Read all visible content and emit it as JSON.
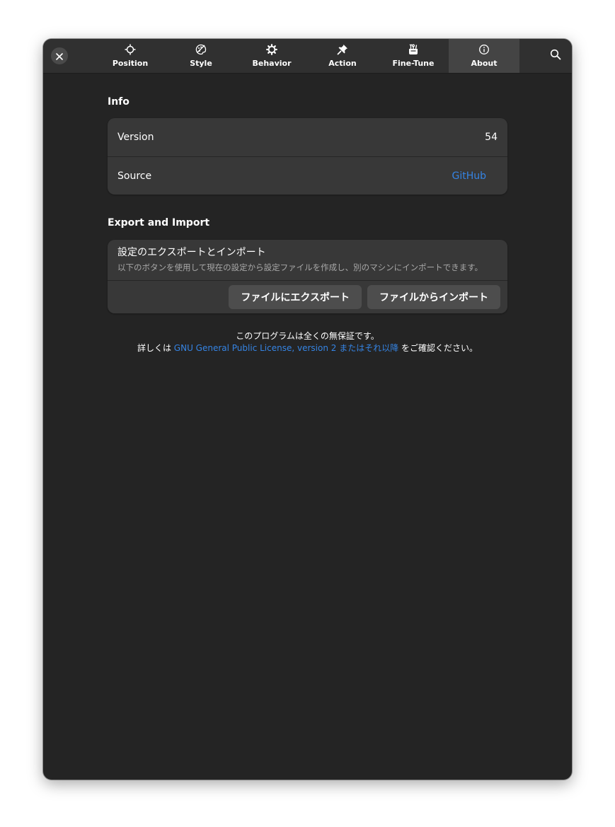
{
  "header": {
    "close_icon": "close-icon",
    "search_icon": "search-icon",
    "tabs": [
      {
        "label": "Position",
        "icon": "crosshair-icon",
        "active": false
      },
      {
        "label": "Style",
        "icon": "palette-icon",
        "active": false
      },
      {
        "label": "Behavior",
        "icon": "gear-icon",
        "active": false
      },
      {
        "label": "Action",
        "icon": "pin-icon",
        "active": false
      },
      {
        "label": "Fine-Tune",
        "icon": "tools-icon",
        "active": false
      },
      {
        "label": "About",
        "icon": "info-icon",
        "active": true
      }
    ]
  },
  "info": {
    "title": "Info",
    "rows": [
      {
        "label": "Version",
        "value": "54"
      },
      {
        "label": "Source",
        "value": "GitHub"
      }
    ]
  },
  "export_import": {
    "title": "Export and Import",
    "heading": "設定のエクスポートとインポート",
    "subtitle": "以下のボタンを使用して現在の設定から設定ファイルを作成し、別のマシンにインポートできます。",
    "export_button": "ファイルにエクスポート",
    "import_button": "ファイルからインポート"
  },
  "footer": {
    "line1": "このプログラムは全くの無保証です。",
    "line2_prefix": "詳しくは ",
    "line2_link": "GNU General Public License, version 2 またはそれ以降",
    "line2_suffix": " をご確認ください。"
  },
  "colors": {
    "background": "#242424",
    "headerbar": "#303030",
    "card": "#383838",
    "accent_link": "#3584e4",
    "active_tab": "#444444"
  }
}
